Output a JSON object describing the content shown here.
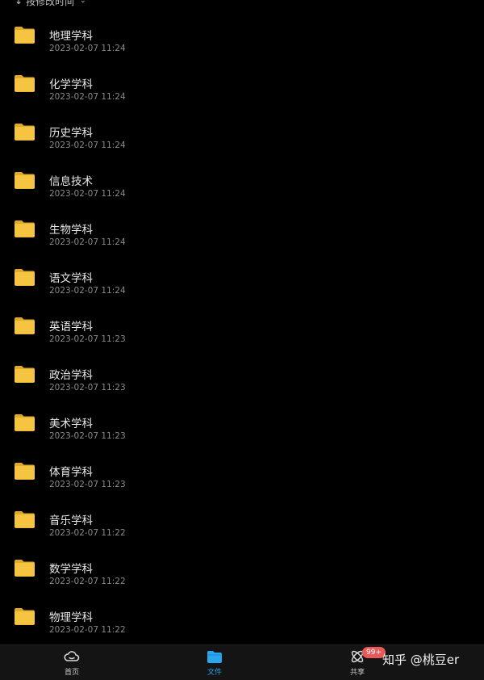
{
  "sort": {
    "label": "按修改时间",
    "arrow": "↓",
    "chevron": "⌄"
  },
  "folders": [
    {
      "name": "地理学科",
      "date": "2023-02-07 11:24"
    },
    {
      "name": "化学学科",
      "date": "2023-02-07 11:24"
    },
    {
      "name": "历史学科",
      "date": "2023-02-07 11:24"
    },
    {
      "name": "信息技术",
      "date": "2023-02-07 11:24"
    },
    {
      "name": "生物学科",
      "date": "2023-02-07 11:24"
    },
    {
      "name": "语文学科",
      "date": "2023-02-07 11:24"
    },
    {
      "name": "英语学科",
      "date": "2023-02-07 11:23"
    },
    {
      "name": "政治学科",
      "date": "2023-02-07 11:23"
    },
    {
      "name": "美术学科",
      "date": "2023-02-07 11:23"
    },
    {
      "name": "体育学科",
      "date": "2023-02-07 11:23"
    },
    {
      "name": "音乐学科",
      "date": "2023-02-07 11:22"
    },
    {
      "name": "数学学科",
      "date": "2023-02-07 11:22"
    },
    {
      "name": "物理学科",
      "date": "2023-02-07 11:22"
    }
  ],
  "tabs": {
    "home": {
      "label": "首页",
      "icon": "cloud-icon"
    },
    "files": {
      "label": "文件",
      "icon": "folder-icon"
    },
    "share": {
      "label": "共享",
      "icon": "share-icon",
      "badge": "99+"
    }
  },
  "watermark": "知乎 @桃豆er",
  "colors": {
    "background": "#000000",
    "folder": "#f5c542",
    "active_tab": "#2aa6f0",
    "badge": "#e85a5a"
  }
}
